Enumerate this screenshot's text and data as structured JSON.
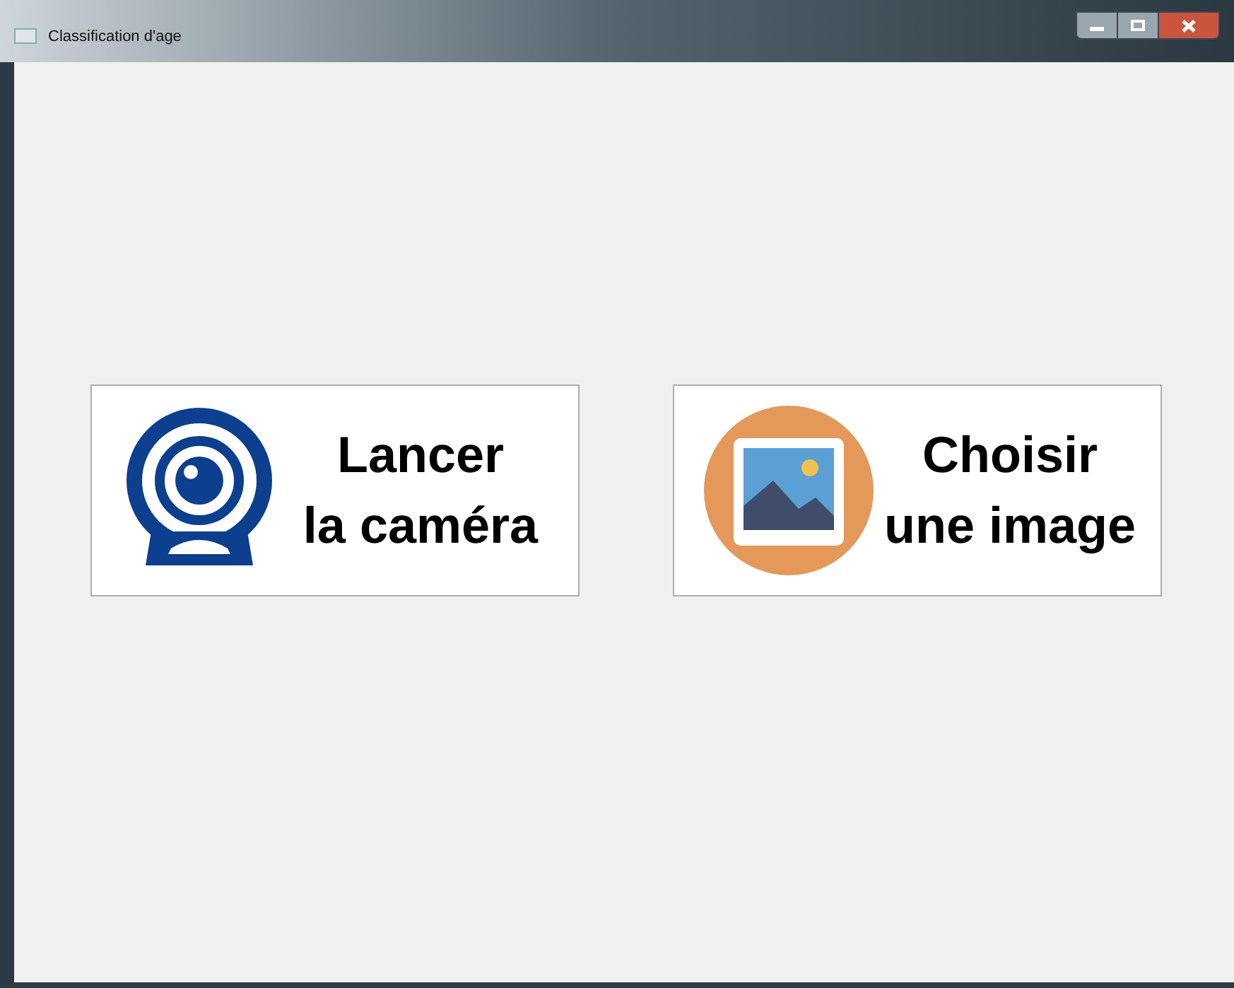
{
  "window": {
    "title": "Classification d'age"
  },
  "buttons": [
    {
      "kind": "camera",
      "lines": [
        "Lancer",
        "la caméra"
      ]
    },
    {
      "kind": "image",
      "lines": [
        "Choisir",
        "une image"
      ]
    }
  ]
}
